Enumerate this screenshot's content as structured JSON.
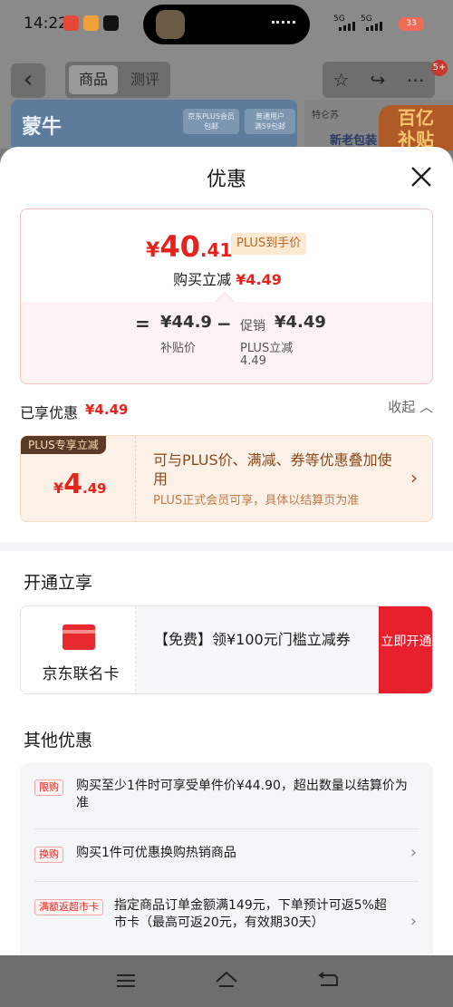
{
  "status_bar": {
    "time": "14:22",
    "network1": "5G",
    "network2": "5G",
    "battery": "33"
  },
  "background": {
    "tabs": [
      "商品",
      "测评"
    ],
    "message_badge": "5+",
    "brand": "蒙牛",
    "banner_tags": [
      "京东PLUS会员\n包邮",
      "普通用户\n满59包邮"
    ],
    "right_banner": {
      "line1": "特仑苏",
      "line2": "新老包装",
      "badge": "百亿\n补贴"
    }
  },
  "sheet": {
    "title": "优惠",
    "price_card": {
      "currency": "¥",
      "final_int": "40",
      "final_dec": ".41",
      "plus_tag": "PLUS到手价",
      "buy_reduce_label": "购买立减",
      "buy_reduce_amount": "¥4.49",
      "equals": "=",
      "minus": "−",
      "subsidy_price": "¥44.9",
      "subsidy_label": "补贴价",
      "promo_prefix": "促销",
      "promo_amount": "¥4.49",
      "promo_label": "PLUS立减",
      "promo_sub": "4.49"
    },
    "enjoyed": {
      "label": "已享优惠",
      "amount": "¥4.49",
      "collapse": "收起"
    },
    "plus_card": {
      "tag": "PLUS专享立减",
      "currency": "¥",
      "int": "4",
      "dec": ".49",
      "desc": "可与PLUS价、满减、券等优惠叠加使用",
      "sub": "PLUS正式会员可享，具体以结算页为准"
    },
    "open_section": {
      "title": "开通立享",
      "card_name": "京东联名卡",
      "desc": "【免费】领¥100元门槛立减券",
      "button": "立即开通"
    },
    "other_section": {
      "title": "其他优惠",
      "items": [
        {
          "tag": "限购",
          "text": "购买至少1件时可享受单件价¥44.90，超出数量以结算价为准"
        },
        {
          "tag": "换购",
          "text": "购买1件可优惠换购热销商品"
        },
        {
          "tag": "满额返超市卡",
          "text": "指定商品订单金额满149元，下单预计可返5%超市卡（最高可返20元，有效期30天）"
        }
      ]
    }
  }
}
